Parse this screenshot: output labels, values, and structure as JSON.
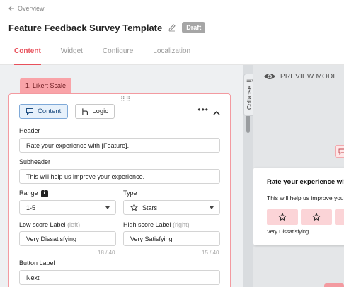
{
  "header": {
    "back_label": "Overview",
    "title": "Feature Feedback Survey Template",
    "status_badge": "Draft",
    "tabs": [
      "Content",
      "Widget",
      "Configure",
      "Localization"
    ]
  },
  "question": {
    "tab_label": "1. Likert Scale",
    "segments": {
      "content": "Content",
      "logic": "Logic"
    },
    "fields": {
      "header_label": "Header",
      "header_value": "Rate your experience with [Feature].",
      "subheader_label": "Subheader",
      "subheader_value": "This will help us improve your experience.",
      "range_label": "Range",
      "range_value": "1-5",
      "type_label": "Type",
      "type_value": "Stars",
      "low_label": "Low score Label",
      "low_hint": "(left)",
      "low_value": "Very Dissatisfying",
      "low_counter": "18 / 40",
      "high_label": "High score Label",
      "high_hint": "(right)",
      "high_value": "Very Satisfying",
      "high_counter": "15 / 40",
      "button_label": "Button Label",
      "button_value": "Next"
    }
  },
  "splitter": {
    "collapse_label": "Collapse"
  },
  "preview": {
    "mode_label": "PREVIEW MODE",
    "card_title": "Rate your experience wit",
    "card_subtitle": "This will help us improve your",
    "low_label": "Very Dissatisfying"
  },
  "colors": {
    "accent": "#e8505b",
    "tab_fill": "#f9a3a8",
    "card_border": "#f39aa0",
    "content_segment": "#e7f1fb",
    "preview_star_bg": "#fbd4d7"
  }
}
